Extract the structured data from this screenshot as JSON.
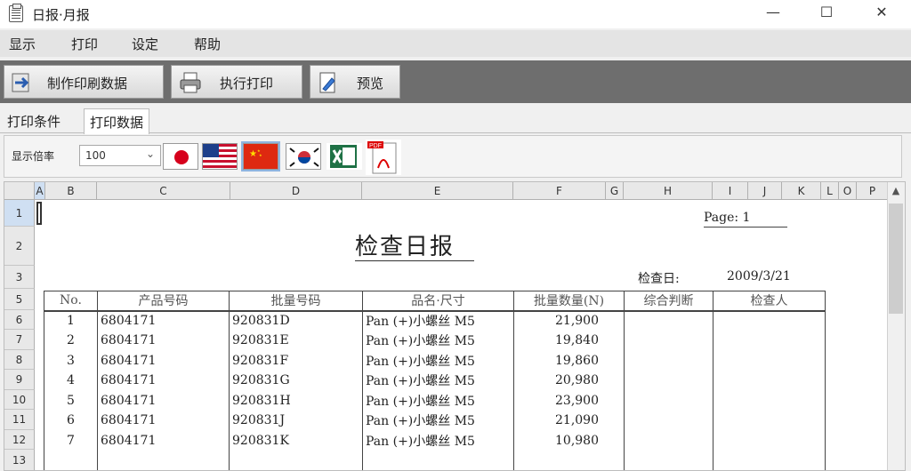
{
  "window": {
    "title": "日报·月报",
    "minimize": "—",
    "maximize": "☐",
    "close": "✕"
  },
  "menu": [
    "显示",
    "打印",
    "设定",
    "帮助"
  ],
  "toolbar": {
    "make_data": "制作印刷数据",
    "exec_print": "执行打印",
    "preview": "预览"
  },
  "tabs": [
    "打印条件",
    "打印数据"
  ],
  "zoom": {
    "label": "显示倍率",
    "value": "100"
  },
  "flags": [
    "japan-flag-icon",
    "usa-flag-icon",
    "china-flag-icon",
    "korea-flag-icon",
    "excel-icon",
    "pdf-icon"
  ],
  "columns": [
    "A",
    "B",
    "C",
    "D",
    "E",
    "F",
    "G",
    "H",
    "I",
    "J",
    "K",
    "L",
    "O",
    "P"
  ],
  "rows": [
    "1",
    "2",
    "3",
    "5",
    "6",
    "7",
    "8",
    "9",
    "10",
    "11",
    "12",
    "13"
  ],
  "report": {
    "page": "Page: 1",
    "title": "检查日报",
    "date_label": "检查日:",
    "date_value": "2009/3/21",
    "headers": [
      "No.",
      "产品号码",
      "批量号码",
      "品名·尺寸",
      "批量数量(N)",
      "综合判断",
      "检查人"
    ],
    "rows": [
      {
        "no": "1",
        "product": "6804171",
        "lot": "920831D",
        "name": "Pan (+)小螺丝 M5",
        "qty": "21,900"
      },
      {
        "no": "2",
        "product": "6804171",
        "lot": "920831E",
        "name": "Pan (+)小螺丝 M5",
        "qty": "19,840"
      },
      {
        "no": "3",
        "product": "6804171",
        "lot": "920831F",
        "name": "Pan (+)小螺丝 M5",
        "qty": "19,860"
      },
      {
        "no": "4",
        "product": "6804171",
        "lot": "920831G",
        "name": "Pan (+)小螺丝 M5",
        "qty": "20,980"
      },
      {
        "no": "5",
        "product": "6804171",
        "lot": "920831H",
        "name": "Pan (+)小螺丝 M5",
        "qty": "23,900"
      },
      {
        "no": "6",
        "product": "6804171",
        "lot": "920831J",
        "name": "Pan (+)小螺丝 M5",
        "qty": "21,090"
      },
      {
        "no": "7",
        "product": "6804171",
        "lot": "920831K",
        "name": "Pan (+)小螺丝 M5",
        "qty": "10,980"
      }
    ]
  }
}
